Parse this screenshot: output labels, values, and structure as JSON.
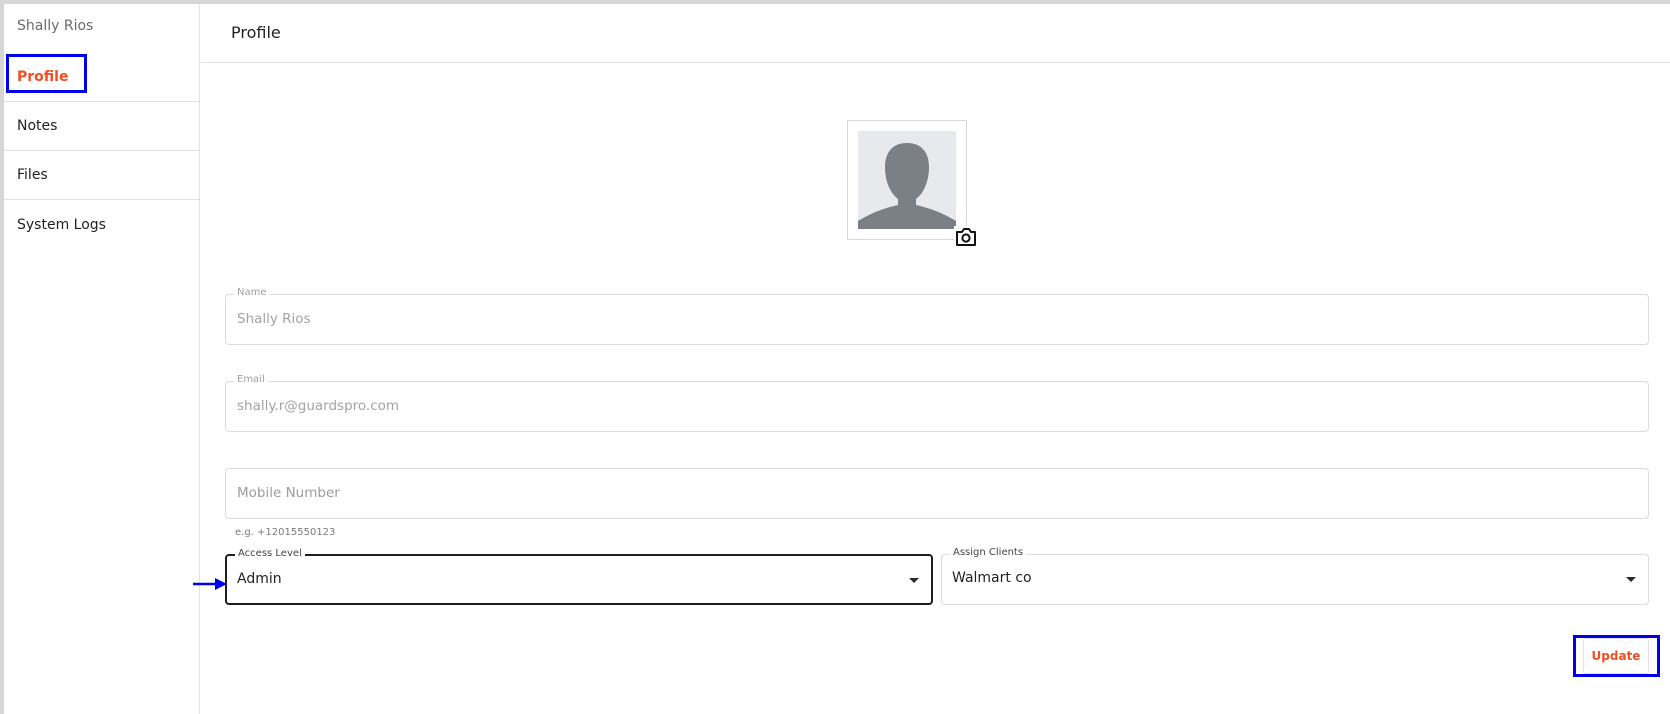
{
  "sidebar": {
    "user_name": "Shally Rios",
    "items": [
      {
        "label": "Profile"
      },
      {
        "label": "Notes"
      },
      {
        "label": "Files"
      },
      {
        "label": "System Logs"
      }
    ]
  },
  "header": {
    "title": "Profile"
  },
  "avatar": {
    "icon": "person-silhouette",
    "camera_icon": "camera-icon"
  },
  "form": {
    "name": {
      "label": "Name",
      "value": "Shally Rios"
    },
    "email": {
      "label": "Email",
      "value": "shally.r@guardspro.com"
    },
    "mobile": {
      "placeholder": "Mobile Number",
      "helper": "e.g. +12015550123"
    },
    "access_level": {
      "label": "Access Level",
      "value": "Admin"
    },
    "assign_clients": {
      "label": "Assign Clients",
      "value": "Walmart co"
    }
  },
  "actions": {
    "update_label": "Update"
  },
  "colors": {
    "accent": "#f04e23",
    "highlight": "#0000ee"
  }
}
